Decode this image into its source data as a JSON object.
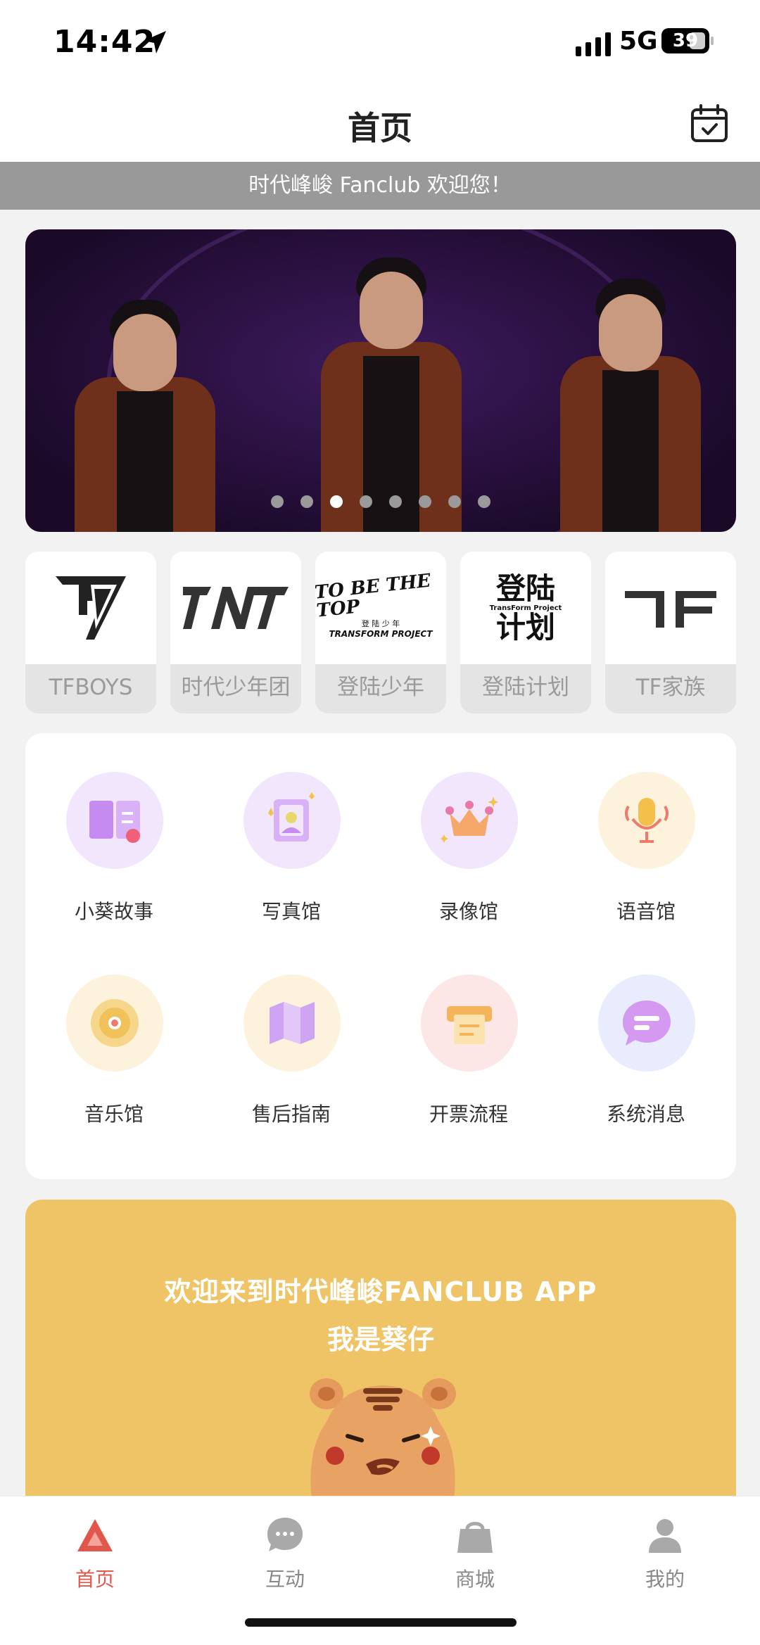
{
  "status_bar": {
    "time": "14:42",
    "network": "5G",
    "battery": "39"
  },
  "header": {
    "title": "首页"
  },
  "welcome_bar": {
    "text": "时代峰峻 Fanclub 欢迎您！"
  },
  "banner": {
    "dot_count": 8,
    "active_dot_index": 2
  },
  "brands": [
    {
      "label": "TFBOYS",
      "logo": "TF"
    },
    {
      "label": "时代少年团",
      "logo": "TNT"
    },
    {
      "label": "登陆少年",
      "logo": "TO BE THE TOP",
      "logo_sub1": "登 陆 少 年",
      "logo_sub2": "TRANSFORM PROJECT"
    },
    {
      "label": "登陆计划",
      "logo_line1": "登陆",
      "logo_line2": "计划",
      "logo_small": "TransForm Project"
    },
    {
      "label": "TF家族",
      "logo": "TF"
    }
  ],
  "grid": [
    {
      "label": "小葵故事",
      "icon": "book-icon",
      "bg": "#f1e6fb"
    },
    {
      "label": "写真馆",
      "icon": "photo-icon",
      "bg": "#f1e6fb"
    },
    {
      "label": "录像馆",
      "icon": "crown-icon",
      "bg": "#f1e6fb"
    },
    {
      "label": "语音馆",
      "icon": "microphone-icon",
      "bg": "#fdf3dc"
    },
    {
      "label": "音乐馆",
      "icon": "disc-icon",
      "bg": "#fdf3dc"
    },
    {
      "label": "售后指南",
      "icon": "map-icon",
      "bg": "#fdf3dc"
    },
    {
      "label": "开票流程",
      "icon": "invoice-icon",
      "bg": "#fde6e6"
    },
    {
      "label": "系统消息",
      "icon": "message-icon",
      "bg": "#e8ecfd"
    }
  ],
  "promo": {
    "line1": "欢迎来到时代峰峻FANCLUB APP",
    "line2": "我是葵仔"
  },
  "tabs": [
    {
      "label": "首页",
      "icon": "home-icon"
    },
    {
      "label": "互动",
      "icon": "chat-icon"
    },
    {
      "label": "商城",
      "icon": "shopping-bag-icon"
    },
    {
      "label": "我的",
      "icon": "profile-icon"
    }
  ],
  "colors": {
    "accent": "#e2574c",
    "promo_bg": "#efc466",
    "welcome_bg": "#999999"
  }
}
